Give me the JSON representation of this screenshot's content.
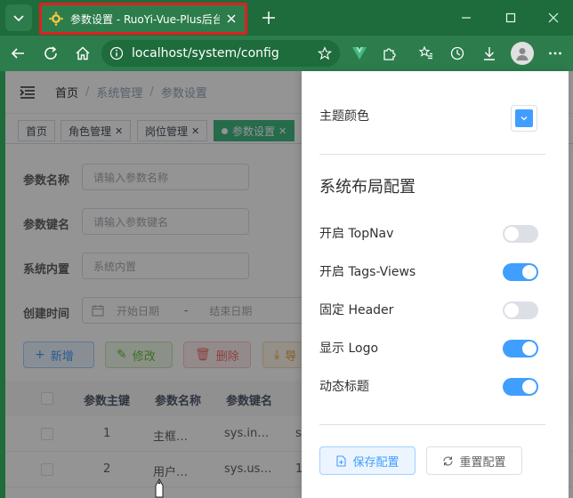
{
  "browser": {
    "tab_title": "参数设置 - RuoYi-Vue-Plus后台管理系统",
    "address": "localhost/system/config"
  },
  "navbar": {
    "breadcrumb": [
      "首页",
      "系统管理",
      "参数设置"
    ]
  },
  "tags": [
    {
      "label": "首页",
      "closable": false,
      "active": false
    },
    {
      "label": "角色管理",
      "closable": true,
      "active": false
    },
    {
      "label": "岗位管理",
      "closable": true,
      "active": false
    },
    {
      "label": "参数设置",
      "closable": true,
      "active": true
    }
  ],
  "search_form": {
    "config_name_label": "参数名称",
    "config_name_placeholder": "请输入参数名称",
    "config_key_label": "参数键名",
    "config_key_placeholder": "请输入参数键名",
    "config_type_label": "系统内置",
    "config_type_placeholder": "系统内置",
    "created_label": "创建时间",
    "start_placeholder": "开始日期",
    "separator": "-",
    "end_placeholder": "结束日期"
  },
  "actions": {
    "add": "新增",
    "edit": "修改",
    "delete": "删除",
    "export": "导"
  },
  "table": {
    "headers": [
      "参数主键",
      "参数名称",
      "参数键名"
    ],
    "rows": [
      {
        "id": "1",
        "name": "主框…",
        "key": "sys.in…",
        "extra": "s"
      },
      {
        "id": "2",
        "name": "用户…",
        "key": "sys.us…",
        "extra": "1"
      }
    ]
  },
  "settings": {
    "theme_color_label": "主题颜色",
    "theme_color": "#409eff",
    "layout_heading": "系统布局配置",
    "toggles": [
      {
        "label": "开启 TopNav",
        "on": false
      },
      {
        "label": "开启 Tags-Views",
        "on": true
      },
      {
        "label": "固定 Header",
        "on": false
      },
      {
        "label": "显示 Logo",
        "on": true
      },
      {
        "label": "动态标题",
        "on": true
      }
    ],
    "save_label": "保存配置",
    "reset_label": "重置配置"
  },
  "colors": {
    "primary": "#409eff",
    "success": "#67c23a",
    "danger": "#f56c6c",
    "warning": "#e6a23c",
    "tag_active": "#42b983",
    "switch_off": "#dcdfe6"
  }
}
